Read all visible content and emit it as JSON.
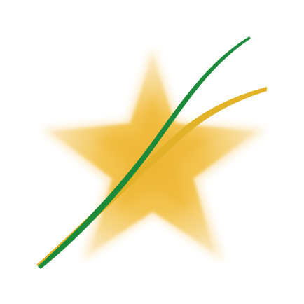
{
  "graphic": {
    "description_icon": "star-with-swooshes-icon",
    "colors": {
      "background": "#ffffff",
      "star_center": "#f0b93a",
      "star_mid": "#f5cd6e",
      "star_edge": "#fbe8bf",
      "swoosh_green": "#1b8a3a",
      "swoosh_gold": "#e2b229"
    }
  }
}
